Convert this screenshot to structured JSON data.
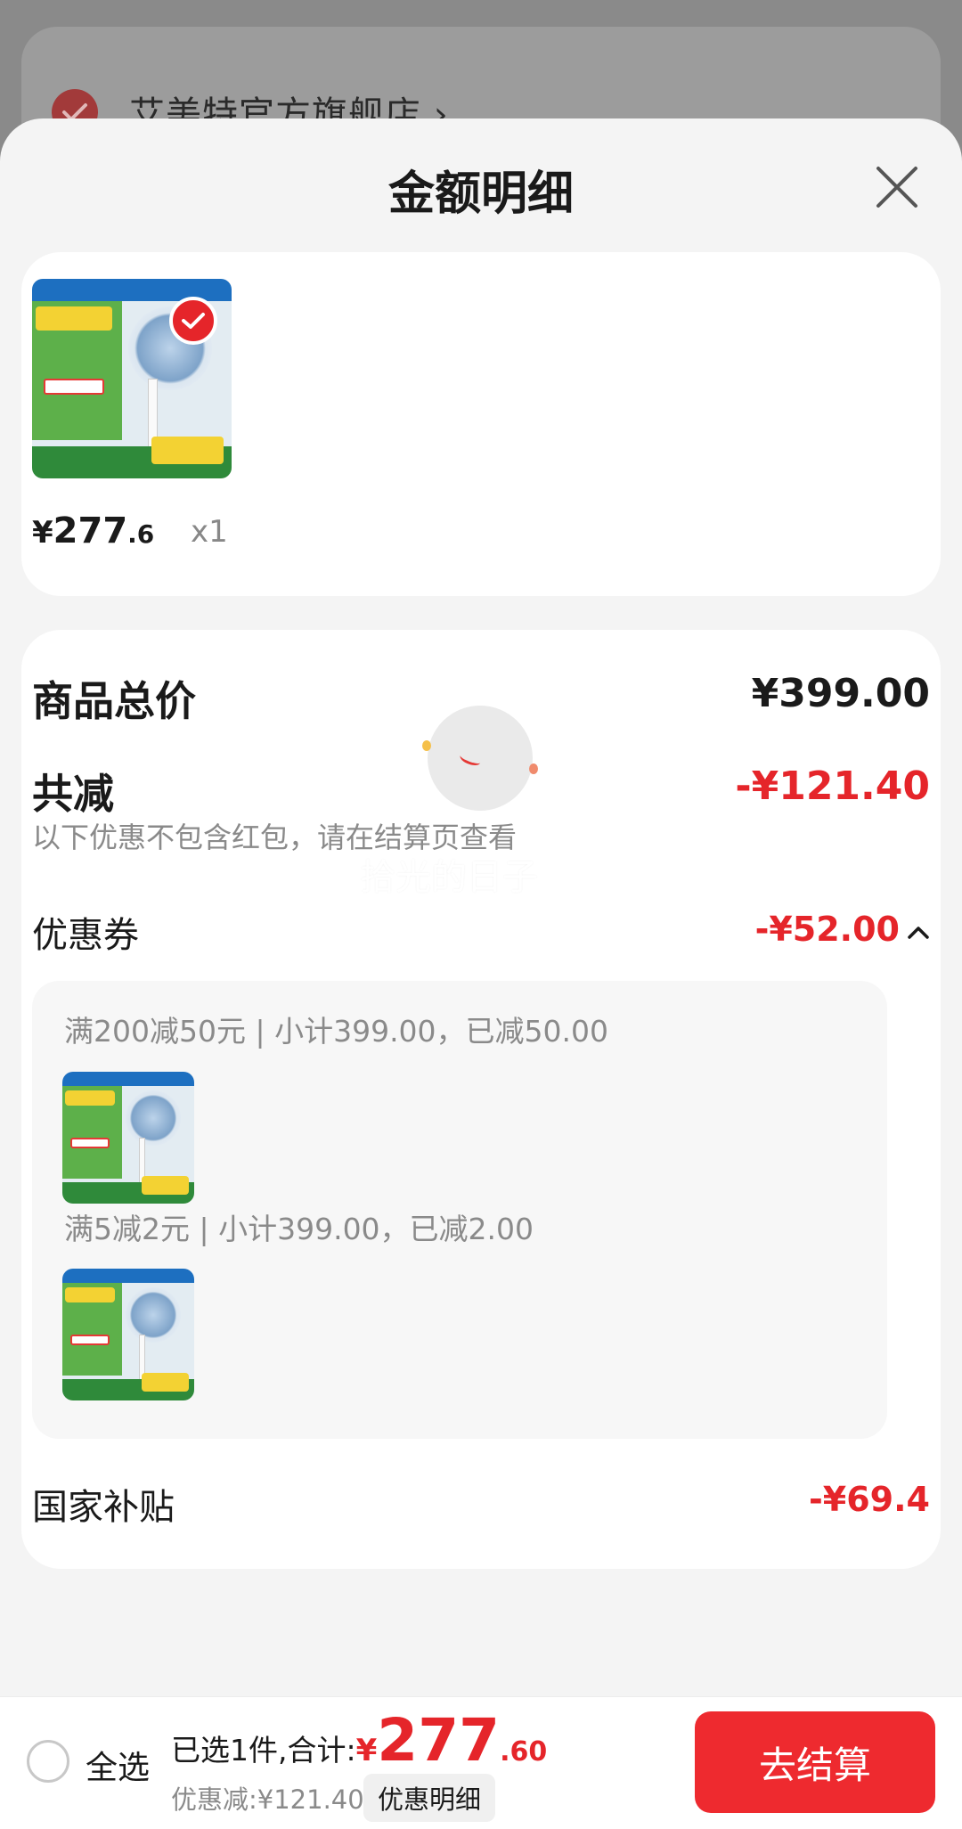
{
  "background": {
    "store_name": "艾美特官方旗舰店 ›"
  },
  "sheet": {
    "title": "金额明细"
  },
  "product": {
    "price_currency": "¥",
    "price_integer": "277",
    "price_decimal": ".6",
    "quantity": "x1"
  },
  "detail": {
    "total_label": "商品总价",
    "total_value": "¥399.00",
    "reduction_label": "共减",
    "reduction_value": "-¥121.40",
    "hint": "以下优惠不包含红包，请在结算页查看",
    "coupon_label": "优惠券",
    "coupon_value": "-¥52.00",
    "coupon_rules": [
      {
        "text": "满200减50元 | 小计399.00，已减50.00"
      },
      {
        "text": "满5减2元 | 小计399.00，已减2.00"
      }
    ],
    "subsidy_label": "国家补贴",
    "subsidy_value": "-¥69.4"
  },
  "overlay": {
    "watermark": "拾光的日子"
  },
  "bottom_bar": {
    "select_all": "全选",
    "selected_text": "已选1件,合计:",
    "total_currency": "¥",
    "total_integer": "277",
    "total_decimal": ".60",
    "discount_text": "优惠减:¥121.40",
    "detail_button": "优惠明细",
    "checkout_button": "去结算"
  },
  "colors": {
    "accent_red": "#e5252a",
    "checkout_red": "#ee2a2f",
    "sheet_bg": "#f4f4f4"
  }
}
